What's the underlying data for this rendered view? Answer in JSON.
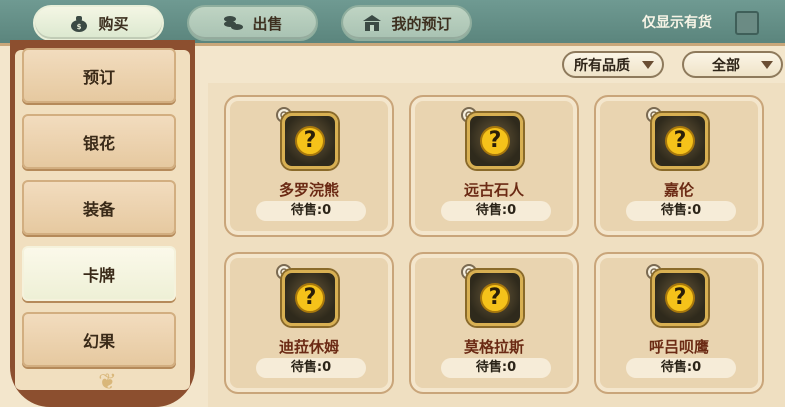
{
  "tabs": [
    {
      "label": "购买",
      "icon": "money-bag-icon",
      "active": true
    },
    {
      "label": "出售",
      "icon": "coins-icon",
      "active": false
    },
    {
      "label": "我的预订",
      "icon": "shop-icon",
      "active": false
    }
  ],
  "stock_filter": {
    "label": "仅显示有货",
    "checked": false
  },
  "sidebar": {
    "items": [
      {
        "label": "预订",
        "active": false
      },
      {
        "label": "银花",
        "active": false
      },
      {
        "label": "装备",
        "active": false
      },
      {
        "label": "卡牌",
        "active": true
      },
      {
        "label": "幻果",
        "active": false
      }
    ]
  },
  "filters": {
    "quality": "所有品质",
    "type": "全部"
  },
  "cards": [
    {
      "name": "多罗浣熊",
      "stock": "待售:0"
    },
    {
      "name": "远古石人",
      "stock": "待售:0"
    },
    {
      "name": "嘉伦",
      "stock": "待售:0"
    },
    {
      "name": "迪菈休姆",
      "stock": "待售:0"
    },
    {
      "name": "莫格拉斯",
      "stock": "待售:0"
    },
    {
      "name": "呼吕呗鹰",
      "stock": "待售:0"
    }
  ],
  "colors": {
    "topbar": "#5b857d",
    "sidebar": "#8c4f2f",
    "card_name": "#6b2a14",
    "question_badge": "#f5c21a"
  }
}
